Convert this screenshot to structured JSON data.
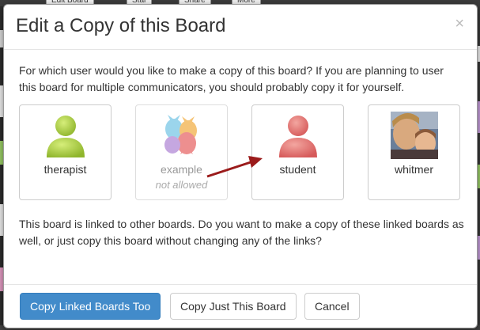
{
  "background": {
    "tabs": [
      "Edit Board",
      "Star",
      "Share",
      "More"
    ]
  },
  "modal": {
    "title": "Edit a Copy of this Board",
    "close_glyph": "×",
    "prompt": "For which user would you like to make a copy of this board? If you are planning to user this board for multiple communicators, you should probably copy it for yourself.",
    "users": [
      {
        "name": "therapist",
        "note": "",
        "allowed": true,
        "avatar": "person-icon",
        "color": "#a6c83e"
      },
      {
        "name": "example",
        "note": "not allowed",
        "allowed": false,
        "avatar": "candy-icon",
        "color": "#e8706a"
      },
      {
        "name": "student",
        "note": "",
        "allowed": true,
        "avatar": "person-icon",
        "color": "#d96a6a"
      },
      {
        "name": "whitmer",
        "note": "",
        "allowed": true,
        "avatar": "photo",
        "color": "#8a6a4a"
      }
    ],
    "linked_text": "This board is linked to other boards. Do you want to make a copy of these linked boards as well, or just copy this board without changing any of the links?",
    "buttons": {
      "copy_linked": "Copy Linked Boards Too",
      "copy_just": "Copy Just This Board",
      "cancel": "Cancel"
    }
  },
  "colors": {
    "primary": "#428bca",
    "arrow": "#9b1b1b"
  }
}
